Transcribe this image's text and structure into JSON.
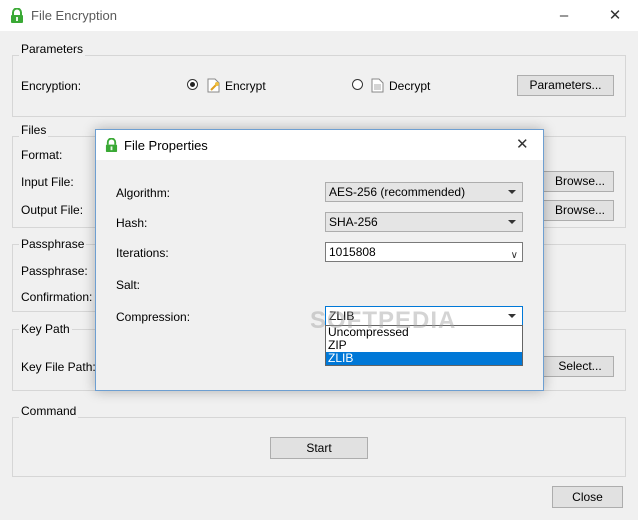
{
  "window": {
    "title": "File Encryption",
    "controls": {
      "minimize": "–",
      "close": "✕"
    }
  },
  "groups": {
    "parameters": {
      "label": "Parameters",
      "encryption_label": "Encryption:",
      "encrypt_option": "Encrypt",
      "decrypt_option": "Decrypt",
      "selected": "Encrypt",
      "parameters_button": "Parameters..."
    },
    "files": {
      "label": "Files",
      "format_label": "Format:",
      "input_label": "Input File:",
      "output_label": "Output File:",
      "browse_input": "Browse...",
      "browse_output": "Browse..."
    },
    "passphrase": {
      "label": "Passphrase",
      "passphrase_label": "Passphrase:",
      "confirmation_label": "Confirmation:"
    },
    "key_path": {
      "label": "Key Path",
      "key_file_label": "Key File Path:",
      "select_button": "Select..."
    },
    "command": {
      "label": "Command",
      "start_button": "Start"
    }
  },
  "close_button": "Close",
  "dialog": {
    "title": "File Properties",
    "algorithm": {
      "label": "Algorithm:",
      "value": "AES-256 (recommended)"
    },
    "hash": {
      "label": "Hash:",
      "value": "SHA-256"
    },
    "iterations": {
      "label": "Iterations:",
      "value": "1015808"
    },
    "salt": {
      "label": "Salt:"
    },
    "compression": {
      "label": "Compression:",
      "value": "ZLIB",
      "options": [
        "Uncompressed",
        "ZIP",
        "ZLIB"
      ],
      "highlighted": "ZLIB"
    }
  },
  "watermark": "SOFTPEDIA",
  "colors": {
    "accent": "#0078d7",
    "dialog_border": "#6e9fd1",
    "icon_green": "#3aa935"
  }
}
